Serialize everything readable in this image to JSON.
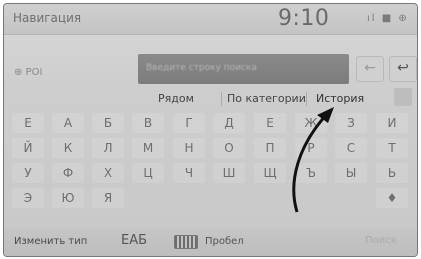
{
  "status_bar": {
    "title": "Навигация",
    "time": "9:10",
    "indicators": "ıl ■ ⊕"
  },
  "search": {
    "poi_label": "⊕ POI",
    "placeholder": "Введите строку поиска",
    "back_icon": "←",
    "return_icon": "↩"
  },
  "tabs": [
    "Рядом",
    "По категории",
    "История"
  ],
  "keyboard": {
    "rows": [
      [
        "Е",
        "А",
        "Б",
        "В",
        "Г",
        "Д",
        "Е",
        "Ж",
        "З",
        "И"
      ],
      [
        "Й",
        "К",
        "Л",
        "М",
        "Н",
        "О",
        "П",
        "Р",
        "С",
        "Т"
      ],
      [
        "У",
        "Ф",
        "Х",
        "Ц",
        "Ч",
        "Ш",
        "Щ",
        "Ъ",
        "Ы",
        "Ь"
      ],
      [
        "Э",
        "Ю",
        "Я",
        "",
        "",
        "",
        "",
        "",
        "",
        "♦"
      ]
    ]
  },
  "bottom_bar": {
    "change_type": "Изменить тип",
    "language": "ЕАБ",
    "space": "Пробел",
    "search_button": "Поиск"
  },
  "annotation": {
    "arrow_color": "#111111"
  }
}
